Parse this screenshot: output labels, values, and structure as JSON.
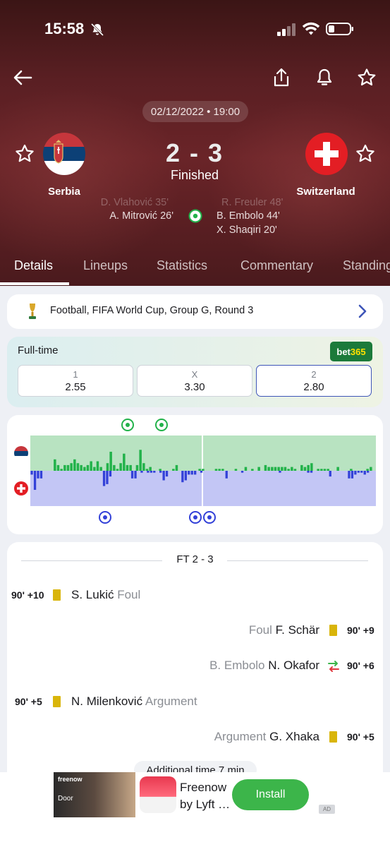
{
  "status_bar": {
    "time": "15:58"
  },
  "match": {
    "datetime": "02/12/2022 • 19:00",
    "score": "2 - 3",
    "status": "Finished",
    "home": {
      "name": "Serbia"
    },
    "away": {
      "name": "Switzerland"
    },
    "home_scorers_faded": "D. Vlahović 35'",
    "home_scorers": "A. Mitrović 26'",
    "away_scorers_faded": "R. Freuler 48'",
    "away_scorers": [
      "B. Embolo 44'",
      "X. Shaqiri 20'"
    ]
  },
  "tabs": [
    "Details",
    "Lineups",
    "Statistics",
    "Commentary",
    "Standings"
  ],
  "competition": {
    "label": "Football, FIFA World Cup, Group G, Round 3"
  },
  "odds": {
    "title": "Full-time",
    "bookmaker": {
      "prefix": "bet",
      "suffix": "365"
    },
    "options": [
      {
        "label": "1",
        "value": "2.55"
      },
      {
        "label": "X",
        "value": "3.30"
      },
      {
        "label": "2",
        "value": "2.80"
      }
    ]
  },
  "momentum": {
    "home_color": "#b8e3c1",
    "away_color": "#c3c6f5",
    "home_bar_color": "#22b24a",
    "away_bar_color": "#3341d8",
    "home": [
      0,
      0,
      0,
      0,
      0,
      0,
      0,
      6,
      3,
      1,
      3,
      3,
      4,
      6,
      4,
      3,
      2,
      3,
      5,
      2,
      5,
      2,
      0,
      4,
      10,
      3,
      1,
      4,
      9,
      3,
      3,
      0,
      3,
      11,
      4,
      1,
      2,
      0,
      0,
      1,
      0,
      0,
      0,
      1,
      3,
      0,
      0,
      0,
      0,
      0,
      0,
      1,
      1,
      0,
      0,
      0,
      1,
      1,
      1,
      0,
      0,
      0,
      1,
      0,
      0,
      2,
      0,
      1,
      0,
      2,
      0,
      3,
      2,
      2,
      2,
      2,
      2,
      2,
      1,
      2,
      1,
      0,
      3,
      2,
      3,
      4,
      0,
      1,
      1,
      1,
      1,
      0,
      0,
      2,
      0,
      0,
      0,
      1,
      0,
      0,
      0,
      0,
      1,
      2,
      0
    ],
    "away": [
      2,
      10,
      4,
      4,
      0,
      0,
      0,
      0,
      0,
      0,
      0,
      0,
      0,
      0,
      0,
      0,
      0,
      0,
      0,
      0,
      0,
      0,
      0,
      8,
      7,
      3,
      0,
      0,
      0,
      0,
      0,
      0,
      4,
      4,
      0,
      1,
      0,
      1,
      1,
      1,
      0,
      1,
      5,
      3,
      0,
      0,
      0,
      0,
      6,
      5,
      2,
      2,
      2,
      0,
      1,
      0,
      0,
      0,
      0,
      0,
      0,
      0,
      4,
      0,
      0,
      0,
      0,
      1,
      0,
      0,
      0,
      0,
      0,
      0,
      0,
      0,
      0,
      0,
      0,
      1,
      0,
      0,
      0,
      0,
      0,
      0,
      0,
      0,
      1,
      1,
      0,
      0,
      0,
      0,
      0,
      3,
      0,
      0,
      0,
      0,
      0,
      4,
      4,
      2,
      1,
      1,
      2,
      1,
      0,
      0
    ]
  },
  "events": {
    "separator": "FT 2 - 3",
    "items": [
      {
        "minute": "90' +10",
        "player": "S. Lukić",
        "reason": "Foul",
        "side": "home",
        "type": "yellow"
      },
      {
        "minute": "90' +9",
        "player": "F. Schär",
        "reason": "Foul",
        "side": "away",
        "type": "yellow"
      },
      {
        "minute": "90' +6",
        "player": "N. Okafor",
        "reason": "B. Embolo",
        "side": "away",
        "type": "substitution"
      },
      {
        "minute": "90' +5",
        "player": "N. Milenković",
        "reason": "Argument",
        "side": "home",
        "type": "yellow"
      },
      {
        "minute": "90' +5",
        "player": "G. Xhaka",
        "reason": "Argument",
        "side": "away",
        "type": "yellow"
      }
    ],
    "additional_time": "Additional time 7 min"
  },
  "ad": {
    "photo_brand": "freenow",
    "photo_caption": "Door",
    "title": "Freenow by Lyft …",
    "install_label": "Install",
    "tag": "AD"
  }
}
